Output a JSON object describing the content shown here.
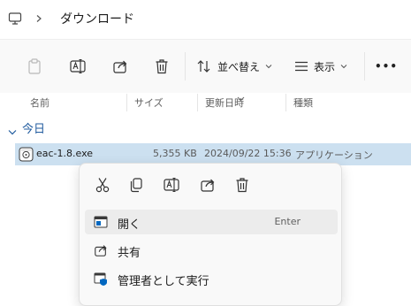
{
  "address": {
    "segments": [
      "ダウンロード"
    ]
  },
  "toolbar": {
    "sort_label": "並べ替え",
    "view_label": "表示",
    "more_label": "•••"
  },
  "columns": {
    "name": "名前",
    "type_size": "サイズ",
    "modified": "更新日時",
    "kind": "種類"
  },
  "group": {
    "label": "今日"
  },
  "file": {
    "name": "eac-1.8.exe",
    "size": "5,355 KB",
    "date": "2024/09/22 15:36",
    "kind": "アプリケーション"
  },
  "context_menu": {
    "items": [
      {
        "label": "開く",
        "shortcut": "Enter"
      },
      {
        "label": "共有"
      },
      {
        "label": "管理者として実行"
      }
    ]
  },
  "colors": {
    "accent": "#0067c0",
    "selection": "#cce0f0"
  }
}
